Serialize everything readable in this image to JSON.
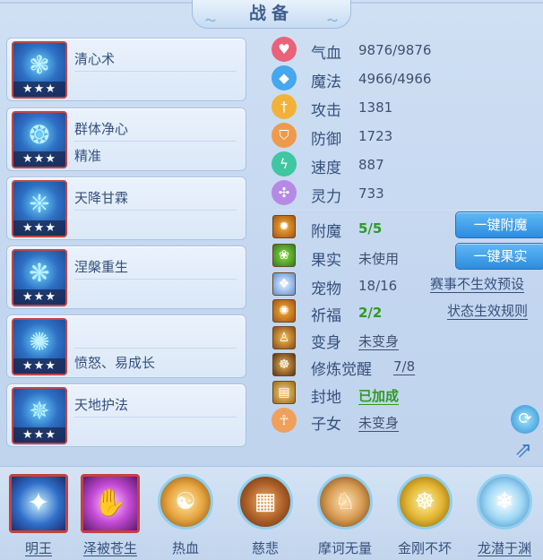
{
  "title": "战备",
  "skills": [
    {
      "name": "清心术",
      "sub": "",
      "stars": "★★★",
      "icon": "swirl-skill-icon"
    },
    {
      "name": "群体净心",
      "sub": "精准",
      "stars": "★★★",
      "icon": "crystal-bird-skill-icon"
    },
    {
      "name": "天降甘霖",
      "sub": "",
      "stars": "★★★",
      "icon": "rain-skill-icon"
    },
    {
      "name": "涅槃重生",
      "sub": "",
      "stars": "★★★",
      "icon": "phoenix-skill-icon"
    },
    {
      "name": "",
      "sub": "愤怒、易成长",
      "stars": "★★★",
      "icon": "shield-skill-icon"
    },
    {
      "name": "天地护法",
      "sub": "",
      "stars": "★★★",
      "icon": "guardian-skill-icon"
    }
  ],
  "stats": [
    {
      "label": "气血",
      "value": "9876/9876",
      "icon": "heart-icon",
      "color": "#e9627a"
    },
    {
      "label": "魔法",
      "value": "4966/4966",
      "icon": "mana-icon",
      "color": "#46a6ee"
    },
    {
      "label": "攻击",
      "value": "1381",
      "icon": "sword-icon",
      "color": "#f2b23a"
    },
    {
      "label": "防御",
      "value": "1723",
      "icon": "shield-icon",
      "color": "#ef9a4a"
    },
    {
      "label": "速度",
      "value": "887",
      "icon": "lightning-icon",
      "color": "#3ec7a0"
    },
    {
      "label": "灵力",
      "value": "733",
      "icon": "spirit-icon",
      "color": "#b58ae6"
    }
  ],
  "extras": [
    {
      "label": "附魔",
      "value": "5/5",
      "icon": "enchant-icon",
      "style": "green"
    },
    {
      "label": "果实",
      "value": "未使用",
      "icon": "fruit-icon",
      "style": "plain"
    },
    {
      "label": "宠物",
      "value": "18/16",
      "icon": "pet-icon",
      "style": "plain"
    },
    {
      "label": "祈福",
      "value": "2/2",
      "icon": "prayer-icon",
      "style": "green"
    },
    {
      "label": "变身",
      "value": "未变身",
      "icon": "transform-icon",
      "style": "underline"
    },
    {
      "label": "修炼觉醒",
      "value": "7/8",
      "icon": "cultivation-icon",
      "style": "underline"
    },
    {
      "label": "封地",
      "value": "已加成",
      "icon": "fief-icon",
      "style": "green-underline"
    },
    {
      "label": "子女",
      "value": "未变身",
      "icon": "child-icon",
      "style": "underline"
    }
  ],
  "buttons": {
    "enchant": "一键附魔",
    "fruit": "一键果实"
  },
  "links": {
    "event_preset": "赛事不生效预设",
    "status_rules": "状态生效规则"
  },
  "bottom": [
    {
      "label": "明王",
      "icon": "radiant-king-icon",
      "kind": "square",
      "underline": true
    },
    {
      "label": "泽被苍生",
      "icon": "blessing-hand-icon",
      "kind": "square",
      "underline": true
    },
    {
      "label": "热血",
      "icon": "monk-icon",
      "kind": "orb",
      "underline": false
    },
    {
      "label": "慈悲",
      "icon": "scroll-icon",
      "kind": "orb",
      "underline": false
    },
    {
      "label": "摩诃无量",
      "icon": "warrior-icon",
      "kind": "orb",
      "underline": false
    },
    {
      "label": "金刚不坏",
      "icon": "golden-buddha-icon",
      "kind": "orb",
      "underline": false
    },
    {
      "label": "龙潜于渊",
      "icon": "dragon-spirit-icon",
      "kind": "orb",
      "underline": true
    }
  ]
}
